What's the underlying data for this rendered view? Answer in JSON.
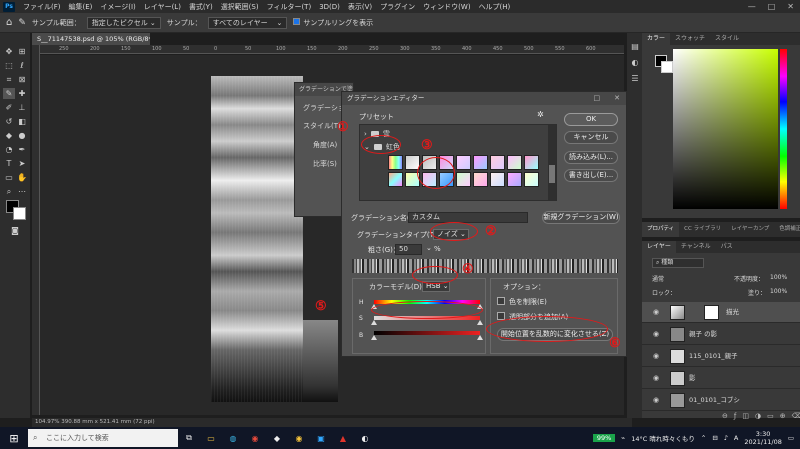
{
  "menubar": {
    "logo": "Ps",
    "items": [
      "ファイル(F)",
      "編集(E)",
      "イメージ(I)",
      "レイヤー(L)",
      "書式(Y)",
      "選択範囲(S)",
      "フィルター(T)",
      "3D(D)",
      "表示(V)",
      "プラグイン",
      "ウィンドウ(W)",
      "ヘルプ(H)"
    ],
    "win_controls": [
      "—",
      "□",
      "✕"
    ]
  },
  "optbar": {
    "sample_size_label": "サンプル範囲：",
    "sample_size_value": "指定したピクセル",
    "sample_label": "サンプル：",
    "sample_value": "すべてのレイヤー",
    "show_ring_label": "サンプルリングを表示"
  },
  "document": {
    "tab_title": "S__71147538.psd @ 105% (RGB/8*) *",
    "status": "104.97%   390.88 mm x 521.41 mm (72 ppi)",
    "ruler_ticks": [
      "250",
      "200",
      "150",
      "100",
      "50",
      "0",
      "50",
      "100",
      "150",
      "200",
      "250",
      "300",
      "350",
      "400",
      "450",
      "500",
      "550",
      "600"
    ]
  },
  "dialog1": {
    "title": "グラデーションで塗りつぶし",
    "rows": [
      "グラデーション",
      "スタイル(T)",
      "角度(A)",
      "比率(S)"
    ]
  },
  "gradient_editor": {
    "title": "グラデーションエディター",
    "presets_label": "プリセット",
    "folders": [
      "雲",
      "虹色"
    ],
    "buttons": {
      "ok": "OK",
      "cancel": "キャンセル",
      "load": "読み込み(L)...",
      "save": "書き出し(E)...",
      "new": "新規グラデーション(W)"
    },
    "name_label": "グラデーション名(N)：",
    "name_value": "カスタム",
    "type_label": "グラデーションタイプ(T)：",
    "type_value": "ノイズ",
    "roughness_label": "粗さ(G)：",
    "roughness_value": "50",
    "roughness_unit": "%",
    "color_model_label": "カラーモデル(D)：",
    "color_model_value": "HSB",
    "channels": [
      "H",
      "S",
      "B"
    ],
    "options_label": "オプション：",
    "opt_restrict": "色を制限(E)",
    "opt_transparency": "透明部分を追加(A)",
    "randomize": "開始位置を乱数的に変化させる(Z)"
  },
  "annotations": [
    "①",
    "②",
    "③",
    "④",
    "⑤",
    "⑥",
    "⑦"
  ],
  "right": {
    "color_tabs": [
      "カラー",
      "スウォッチ",
      "スタイル"
    ],
    "props_tabs": [
      "プロパティ",
      "CC ライブラリ",
      "レイヤーカンプ",
      "色調補正"
    ],
    "layer_tabs": [
      "レイヤー",
      "チャンネル",
      "パス"
    ],
    "kind_label": "種類",
    "blend_label": "通常",
    "opacity_label": "不透明度：",
    "opacity_value": "100%",
    "lock_label": "ロック：",
    "fill_label": "塗り：",
    "fill_value": "100%",
    "layers": [
      "描光",
      "親子 の影",
      "115_0101_親子",
      "影",
      "01_0101_コブシ"
    ]
  },
  "taskbar": {
    "search_placeholder": "ここに入力して検索",
    "battery": "99%",
    "weather": "14°C  晴れ時々くもり",
    "ime": "A",
    "time": "3:30",
    "date": "2021/11/08"
  },
  "colors": {
    "annotation": "#e11a1a",
    "picker_hue": "#c8ff00"
  }
}
